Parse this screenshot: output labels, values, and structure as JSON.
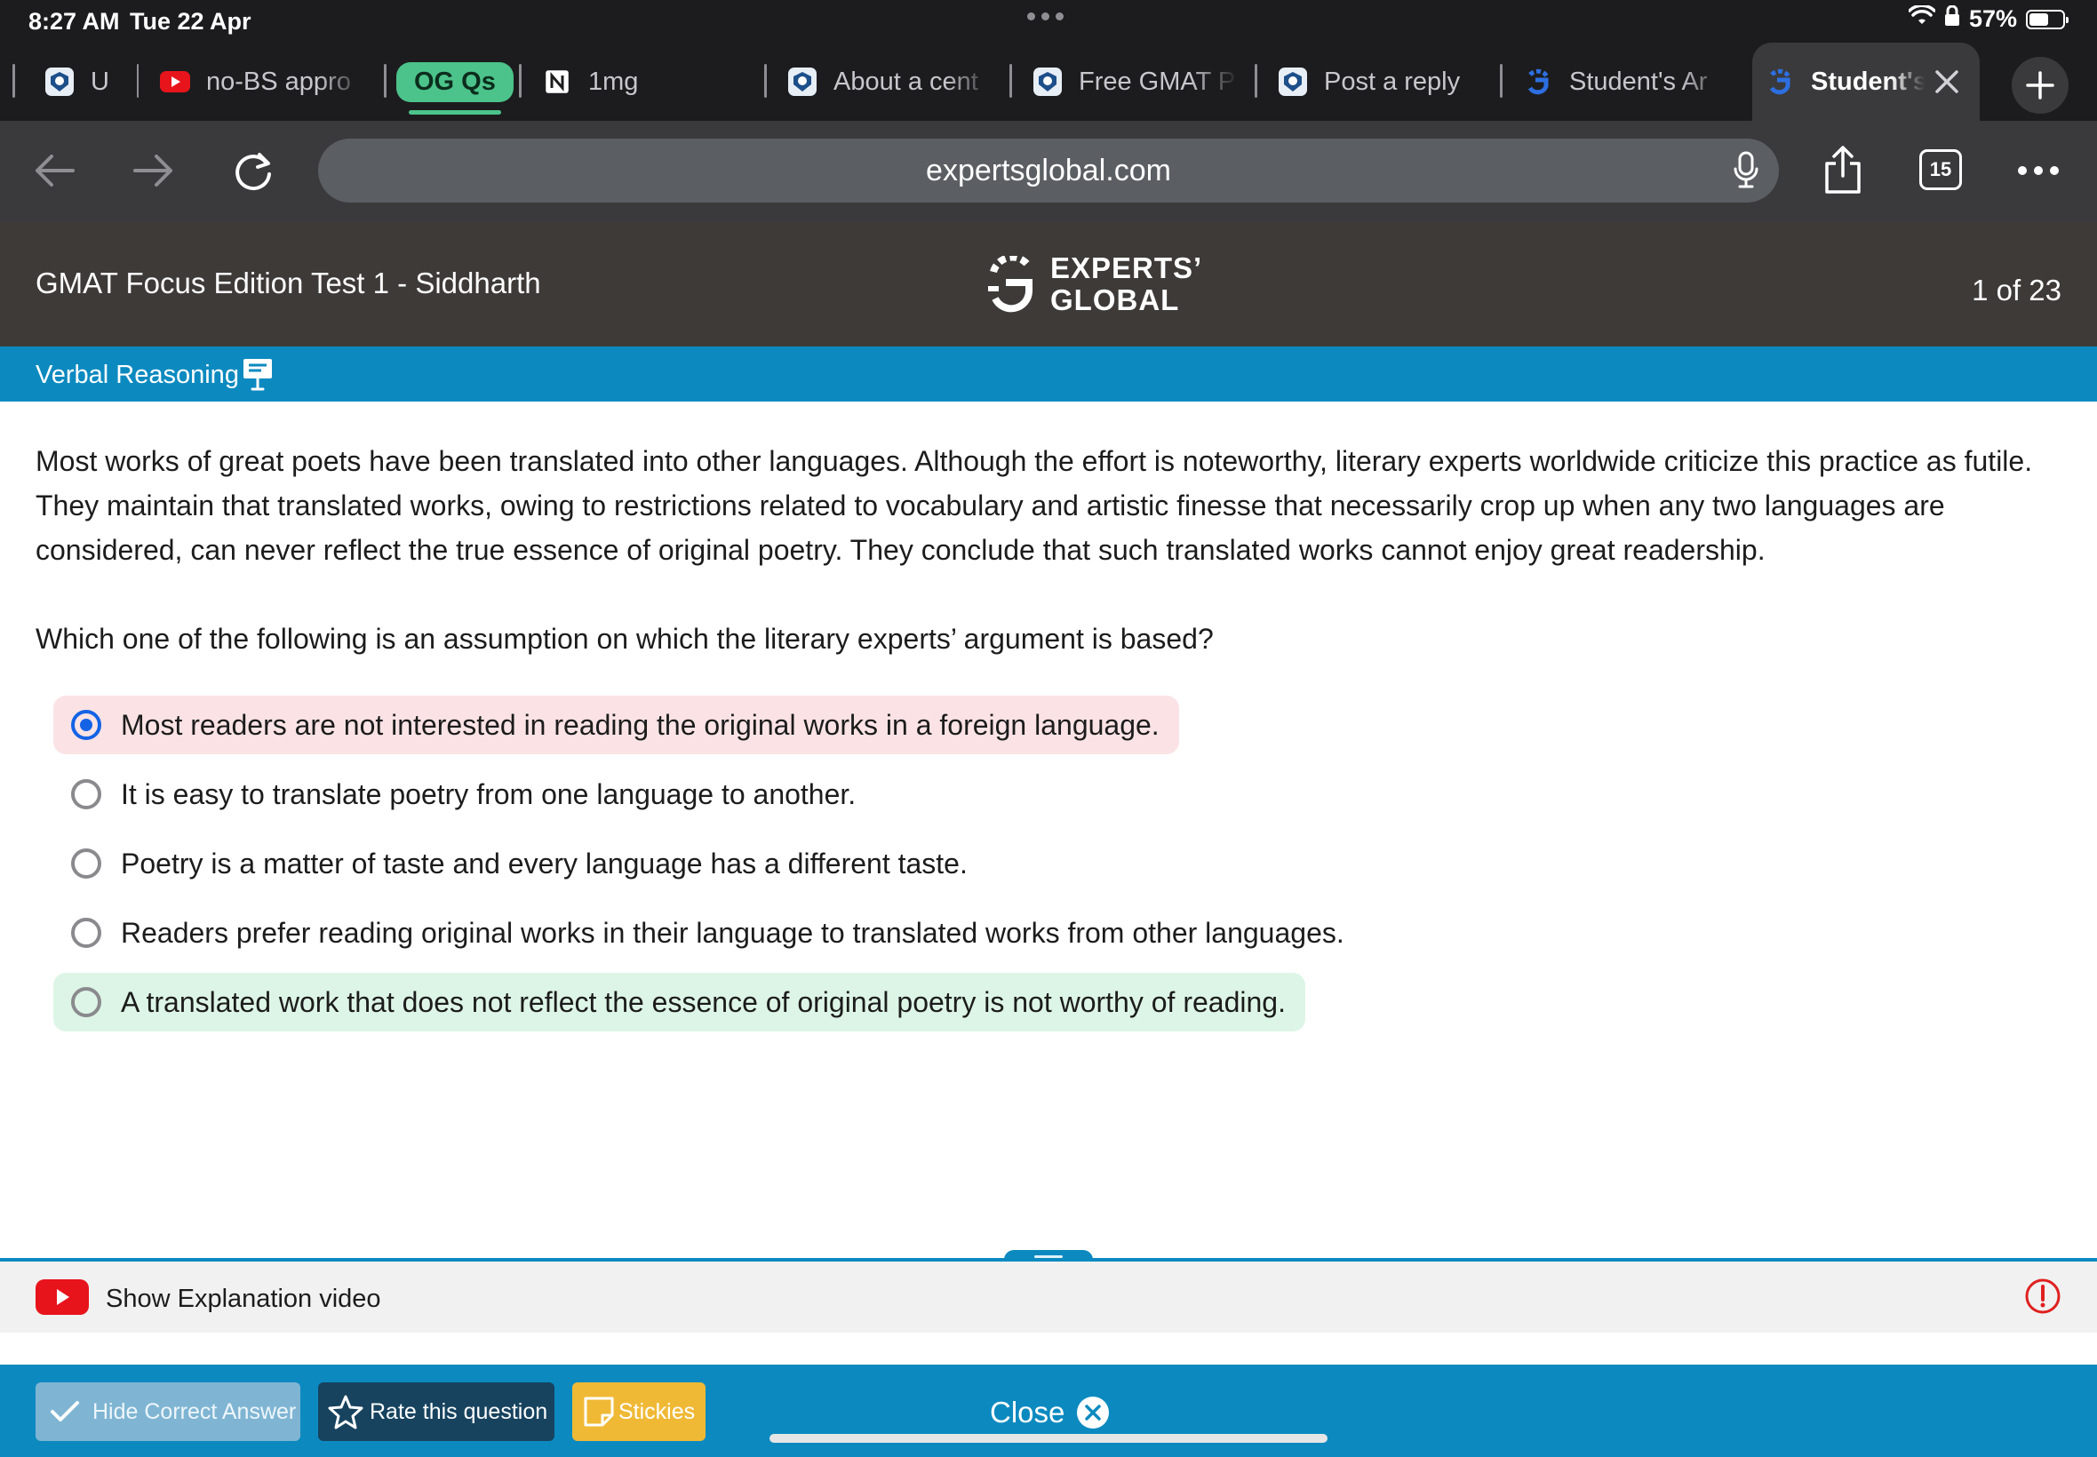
{
  "status_bar": {
    "time": "8:27 AM",
    "date": "Tue 22 Apr",
    "battery": "57%",
    "battery_level": 0.57
  },
  "tabs": [
    {
      "label": "U",
      "icon": "experts-global-favicon"
    },
    {
      "label": "no-BS appro",
      "icon": "youtube-favicon"
    },
    {
      "label": "OG Qs",
      "icon": "tab-group-pill"
    },
    {
      "label": "1mg",
      "icon": "notion-favicon"
    },
    {
      "label": "About a cent",
      "icon": "experts-global-favicon"
    },
    {
      "label": "Free GMAT P",
      "icon": "experts-global-favicon"
    },
    {
      "label": "Post a reply",
      "icon": "experts-global-favicon"
    },
    {
      "label": "Student's Ar",
      "icon": "experts-global-blue-favicon"
    },
    {
      "label": "Student's",
      "icon": "experts-global-blue-favicon",
      "active": true
    }
  ],
  "toolbar": {
    "url": "expertsglobal.com",
    "tab_count": "15"
  },
  "header": {
    "test_title": "GMAT Focus Edition Test 1 - Siddharth",
    "brand_line1": "EXPERTS’",
    "brand_line2": "GLOBAL",
    "question_counter": "1 of 23"
  },
  "section": {
    "name": "Verbal Reasoning",
    "icon": "presentation-board-icon"
  },
  "question": {
    "passage": "Most works of great poets have been translated into other languages. Although the effort is noteworthy, literary experts worldwide criticize this practice as futile. They maintain that translated works, owing to restrictions related to vocabulary and artistic finesse that necessarily crop up when any two languages are considered, can never reflect the true essence of original poetry. They conclude that such translated works cannot enjoy great readership.",
    "stem": "Which one of the following is an assumption on which the literary experts’ argument is based?",
    "options": [
      {
        "text": "Most readers are not interested in reading the original works in a foreign language.",
        "state": "selected-incorrect"
      },
      {
        "text": "It is easy to translate poetry from one language to another.",
        "state": "none"
      },
      {
        "text": "Poetry is a matter of taste and every language has a different taste.",
        "state": "none"
      },
      {
        "text": "Readers prefer reading original works in their language to translated works from other languages.",
        "state": "none"
      },
      {
        "text": "A translated work that does not reflect the essence of original poetry is not worthy of reading.",
        "state": "correct"
      }
    ]
  },
  "explanation": {
    "video_label": "Show Explanation video"
  },
  "footer": {
    "hide_answer": "Hide Correct Answer",
    "rate": "Rate this question",
    "stickies": "Stickies",
    "close": "Close"
  },
  "colors": {
    "accent": "#0c8ac0",
    "header_bg": "#3d3a38",
    "selected_bg": "#fbe3e5",
    "correct_bg": "#ddf5e6",
    "radio_selected": "#1463e5",
    "stickies": "#f0b935",
    "youtube": "#e8141c"
  }
}
